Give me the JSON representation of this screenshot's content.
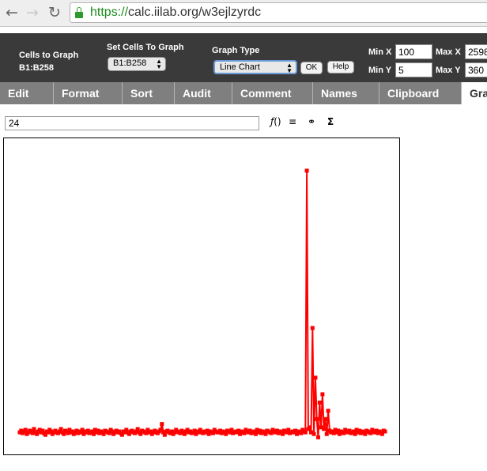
{
  "browser": {
    "url_protocol": "https://",
    "url_rest": "calc.iilab.org/w3ejlzyrdc"
  },
  "header": {
    "cells_to_graph_label": "Cells to Graph",
    "cells_to_graph_value": "B1:B258",
    "set_cells_label": "Set Cells To Graph",
    "set_cells_value": "B1:B258",
    "graph_type_label": "Graph Type",
    "graph_type_value": "Line Chart",
    "ok_label": "OK",
    "help_label": "Help",
    "min_x_label": "Min X",
    "min_x_value": "100",
    "max_x_label": "Max X",
    "max_x_value": "2598",
    "min_y_label": "Min Y",
    "min_y_value": "5",
    "max_y_label": "Max Y",
    "max_y_value": "360"
  },
  "tabs": [
    "Edit",
    "Format",
    "Sort",
    "Audit",
    "Comment",
    "Names",
    "Clipboard",
    "Graph"
  ],
  "active_tab": "Graph",
  "formula_value": "24",
  "icons": [
    "function-icon",
    "align-icon",
    "link-icon",
    "sum-icon"
  ],
  "chart_data": {
    "type": "line",
    "color": "#ff0000",
    "series_note": "",
    "x_start": 1,
    "x_end": 258,
    "ylim": [
      5,
      360
    ],
    "y": [
      24,
      26,
      23,
      25,
      27,
      22,
      24,
      26,
      25,
      23,
      28,
      24,
      22,
      25,
      27,
      24,
      26,
      23,
      21,
      25,
      24,
      27,
      25,
      22,
      24,
      26,
      24,
      23,
      25,
      28,
      24,
      22,
      26,
      25,
      23,
      27,
      24,
      25,
      22,
      24,
      26,
      23,
      25,
      24,
      27,
      22,
      25,
      24,
      26,
      23,
      24,
      25,
      22,
      27,
      24,
      26,
      23,
      25,
      24,
      22,
      26,
      25,
      24,
      23,
      27,
      25,
      22,
      24,
      26,
      24,
      25,
      23,
      21,
      25,
      24,
      27,
      24,
      22,
      25,
      26,
      24,
      23,
      25,
      28,
      24,
      22,
      26,
      25,
      24,
      23,
      27,
      24,
      25,
      22,
      24,
      26,
      24,
      23,
      25,
      27,
      34,
      24,
      21,
      25,
      26,
      24,
      23,
      25,
      22,
      24,
      27,
      25,
      24,
      23,
      26,
      24,
      22,
      25,
      27,
      24,
      25,
      23,
      24,
      26,
      22,
      25,
      24,
      27,
      24,
      23,
      25,
      24,
      26,
      22,
      25,
      24,
      23,
      27,
      25,
      24,
      24,
      26,
      23,
      25,
      24,
      22,
      26,
      25,
      24,
      27,
      23,
      24,
      25,
      24,
      26,
      22,
      25,
      24,
      23,
      27,
      25,
      24,
      26,
      23,
      24,
      25,
      22,
      27,
      24,
      26,
      23,
      25,
      24,
      22,
      26,
      25,
      24,
      23,
      27,
      25,
      24,
      26,
      23,
      25,
      24,
      22,
      26,
      25,
      24,
      27,
      23,
      24,
      25,
      24,
      26,
      22,
      25,
      24,
      23,
      27,
      25,
      24,
      340,
      28,
      30,
      24,
      150,
      22,
      90,
      40,
      18,
      60,
      30,
      70,
      28,
      40,
      22,
      50,
      26,
      24,
      25,
      23,
      27,
      24,
      26,
      22,
      25,
      24,
      23,
      27,
      25,
      24,
      26,
      23,
      24,
      25,
      22,
      27,
      24,
      26,
      23,
      25,
      24,
      22,
      26,
      25,
      24,
      23,
      27,
      25,
      24,
      26,
      23,
      25,
      24,
      22,
      26,
      25
    ]
  }
}
